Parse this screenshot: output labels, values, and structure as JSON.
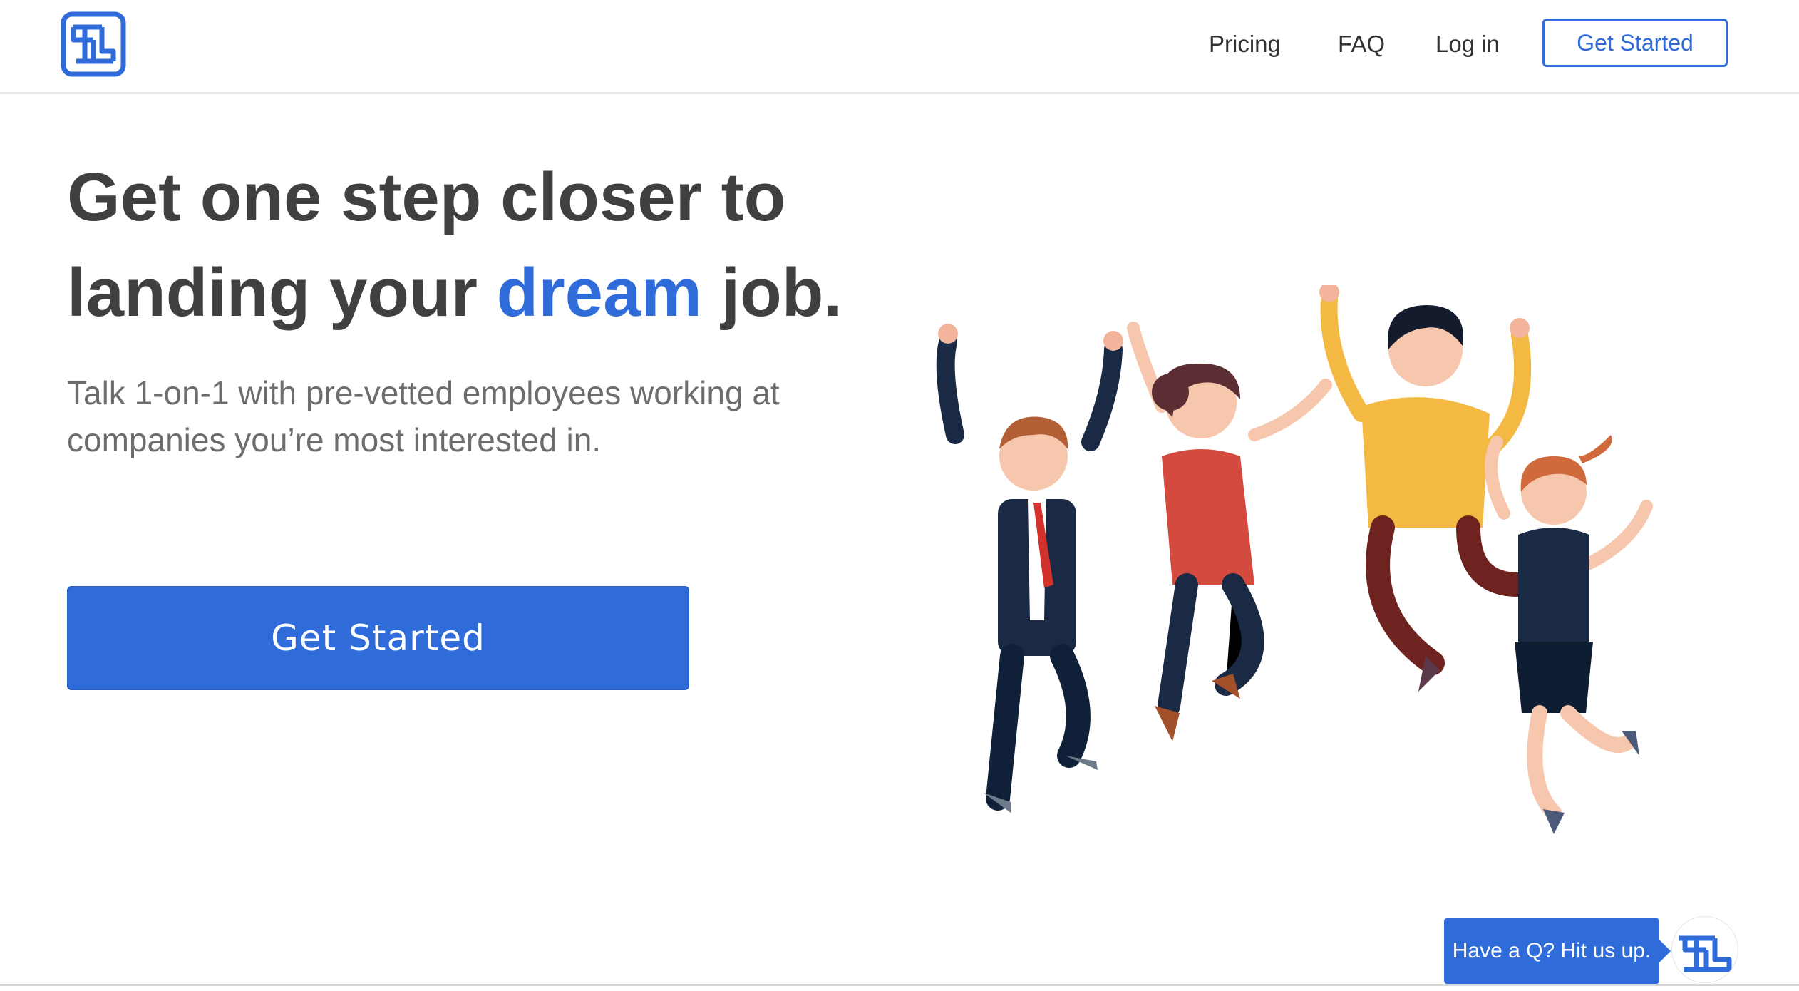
{
  "header": {
    "logo_icon": "brand-logo-icon",
    "nav": {
      "pricing": "Pricing",
      "faq": "FAQ",
      "login": "Log in",
      "cta": "Get Started"
    }
  },
  "hero": {
    "title_line1": "Get one step closer to",
    "title_line2_before": "landing your ",
    "title_line2_accent": "dream",
    "title_line2_after": " job.",
    "subtitle_line1": "Talk 1-on-1 with pre-vetted employees working at",
    "subtitle_line2": "companies you’re most interested in.",
    "cta": "Get Started"
  },
  "illustration": {
    "icon": "jumping-people-illustration"
  },
  "chat": {
    "label": "Have a Q? Hit us up.",
    "avatar_icon": "brand-logo-icon"
  },
  "colors": {
    "accent": "#2f6bd9",
    "heading": "#404040",
    "subtext": "#6d6d6d"
  }
}
